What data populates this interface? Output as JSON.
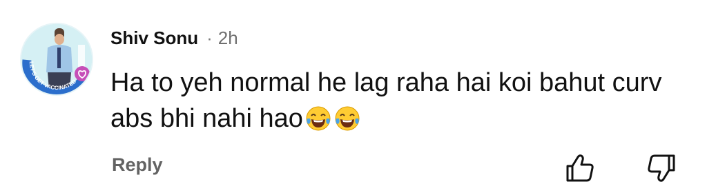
{
  "comment": {
    "author": "Shiv Sonu",
    "separator": "·",
    "time": "2h",
    "text": "Ha to yeh normal he lag raha hai koi bahut curv abs bhi nahi hao",
    "emojis": [
      "face-with-tears-of-joy-icon",
      "face-with-tears-of-joy-icon"
    ],
    "avatar_badge": "LET'S GET VACCINATED"
  },
  "actions": {
    "reply_label": "Reply",
    "like_icon": "thumbs-up-icon",
    "dislike_icon": "thumbs-down-icon"
  },
  "colors": {
    "text": "#111111",
    "muted": "#6f6f6f",
    "avatar_ring": "#2b6ecc",
    "badge": "#c64fb8"
  }
}
